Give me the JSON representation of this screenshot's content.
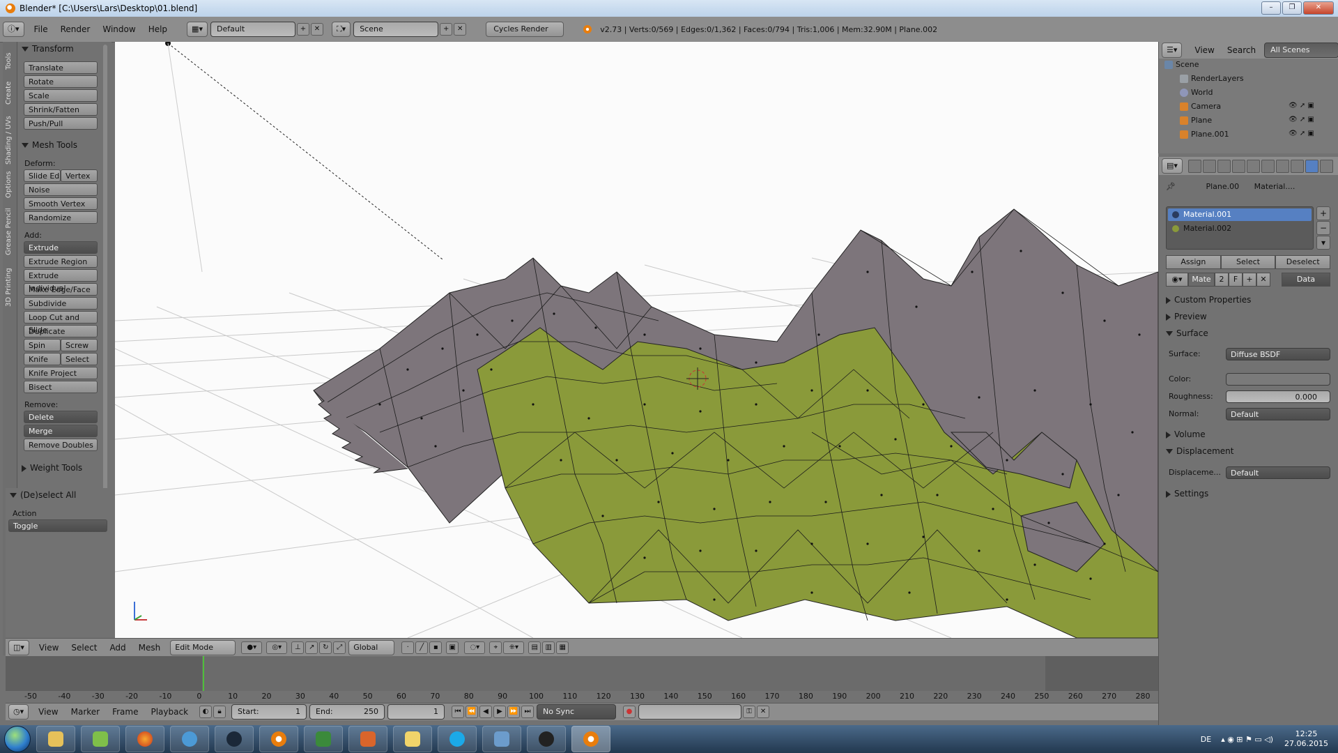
{
  "window": {
    "title": "Blender* [C:\\Users\\Lars\\Desktop\\01.blend]",
    "controls": [
      "–",
      "❐",
      "✕"
    ]
  },
  "info_header": {
    "menus": [
      "File",
      "Render",
      "Window",
      "Help"
    ],
    "screen_layout": "Default",
    "scene": "Scene",
    "render_engine": "Cycles Render",
    "stats": "v2.73 | Verts:0/569 | Edges:0/1,362 | Faces:0/794 | Tris:1,006 | Mem:32.90M | Plane.002"
  },
  "tool_tabs": [
    "Tools",
    "Create",
    "Shading / UVs",
    "Options",
    "Grease Pencil",
    "3D Printing"
  ],
  "toolshelf": {
    "transform": {
      "title": "Transform",
      "buttons": [
        "Translate",
        "Rotate",
        "Scale",
        "Shrink/Fatten",
        "Push/Pull"
      ]
    },
    "mesh_tools": {
      "title": "Mesh Tools",
      "deform_label": "Deform:",
      "slide_edge": "Slide Ed",
      "vertex": "Vertex",
      "noise": "Noise",
      "smooth_vertex": "Smooth Vertex",
      "randomize": "Randomize",
      "add_label": "Add:",
      "extrude": "Extrude",
      "extrude_region": "Extrude Region",
      "extrude_individual": "Extrude Individual",
      "make_edge_face": "Make Edge/Face",
      "subdivide": "Subdivide",
      "loop_cut": "Loop Cut and Slide",
      "duplicate": "Duplicate",
      "spin": "Spin",
      "screw": "Screw",
      "knife": "Knife",
      "select": "Select",
      "knife_project": "Knife Project",
      "bisect": "Bisect",
      "remove_label": "Remove:",
      "delete": "Delete",
      "merge": "Merge",
      "remove_doubles": "Remove Doubles"
    },
    "weight_tools": "Weight Tools",
    "operator": {
      "title": "(De)select All",
      "action_label": "Action",
      "action_value": "Toggle"
    }
  },
  "view3d_header": {
    "menus": [
      "View",
      "Select",
      "Add",
      "Mesh"
    ],
    "mode": "Edit Mode",
    "orientation": "Global"
  },
  "timeline": {
    "ticks": [
      "-50",
      "-40",
      "-30",
      "-20",
      "-10",
      "0",
      "10",
      "20",
      "30",
      "40",
      "50",
      "60",
      "70",
      "80",
      "90",
      "100",
      "110",
      "120",
      "130",
      "140",
      "150",
      "160",
      "170",
      "180",
      "190",
      "200",
      "210",
      "220",
      "230",
      "240",
      "250",
      "260",
      "270",
      "280"
    ],
    "current_frame_value": 1,
    "menus": [
      "View",
      "Marker",
      "Frame",
      "Playback"
    ],
    "start_label": "Start:",
    "start": "1",
    "end_label": "End:",
    "end": "250",
    "current": "1",
    "sync": "No Sync"
  },
  "outliner": {
    "menus": [
      "View",
      "Search"
    ],
    "filter": "All Scenes",
    "items": [
      "Scene",
      "RenderLayers",
      "World",
      "Camera",
      "Plane",
      "Plane.001"
    ]
  },
  "properties": {
    "breadcrumb_object": "Plane.00",
    "breadcrumb_material": "Material....",
    "materials": [
      "Material.001",
      "Material.002"
    ],
    "assign": "Assign",
    "select": "Select",
    "deselect": "Deselect",
    "material_field": "Mate",
    "material_users": "2",
    "fake_user": "F",
    "link": "Data",
    "sections": {
      "custom_properties": "Custom Properties",
      "preview": "Preview",
      "surface": "Surface",
      "volume": "Volume",
      "displacement": "Displacement",
      "settings": "Settings"
    },
    "surface_label": "Surface:",
    "surface_value": "Diffuse BSDF",
    "color_label": "Color:",
    "roughness_label": "Roughness:",
    "roughness_value": "0.000",
    "normal_label": "Normal:",
    "normal_value": "Default",
    "displacement_label": "Displaceme...",
    "displacement_value": "Default"
  },
  "taskbar": {
    "language": "DE",
    "time": "12:25",
    "date": "27.06.2015"
  },
  "colors": {
    "mesh_green": "#8a9a3a",
    "mesh_grey": "#7d757b",
    "selection_blue": "#5680c2",
    "timeline_cursor": "#4fbf3a"
  }
}
